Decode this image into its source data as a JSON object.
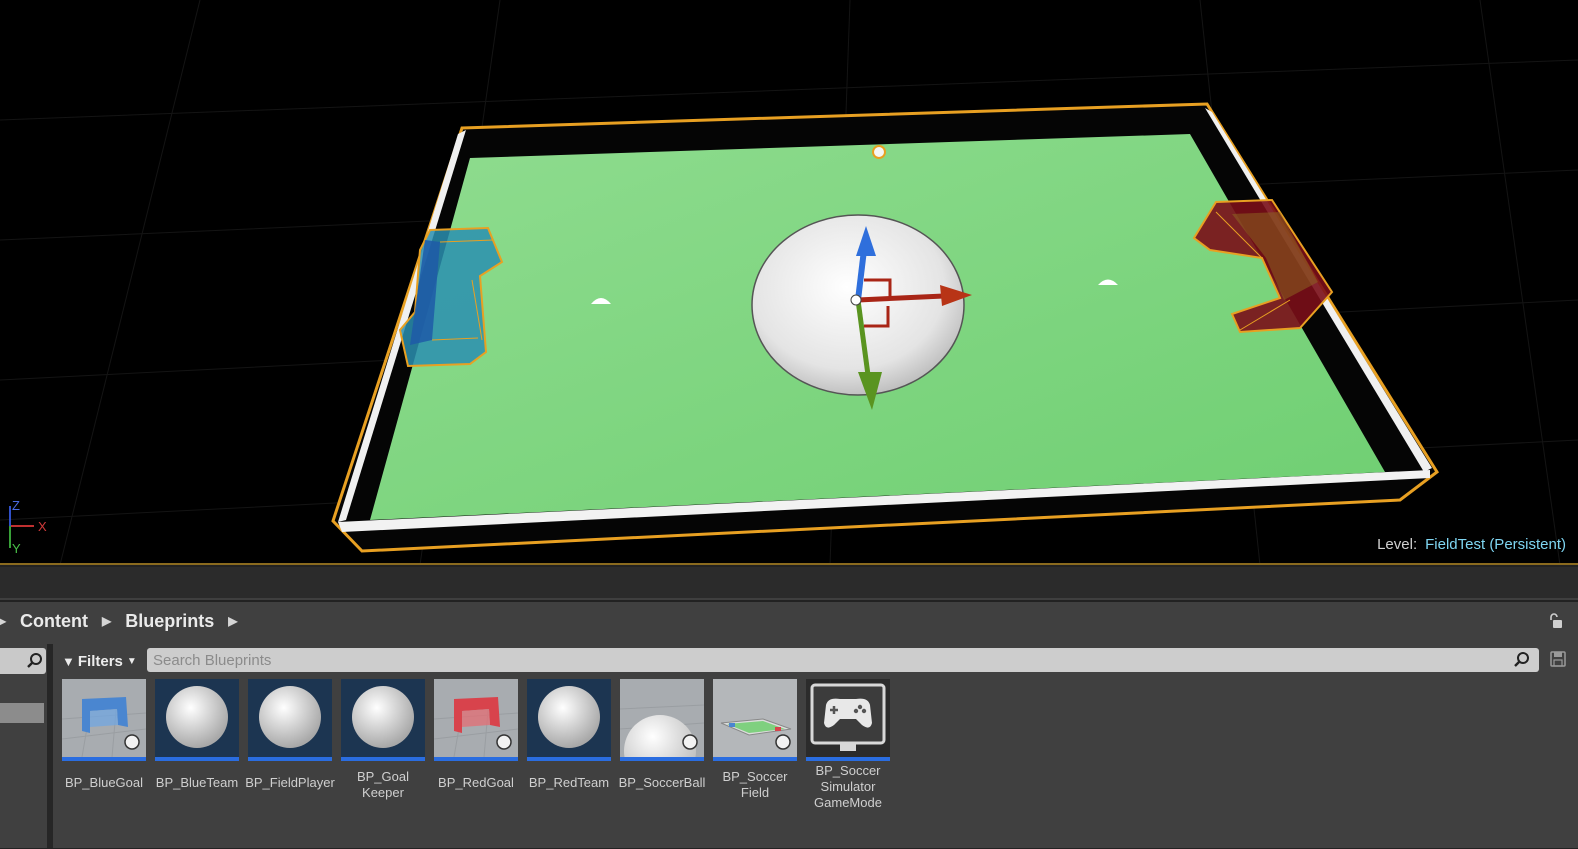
{
  "viewport": {
    "level_key": "Level:",
    "level_name": "FieldTest (Persistent)",
    "axis_labels": {
      "x": "X",
      "y": "Y",
      "z": "Z"
    }
  },
  "content_browser": {
    "breadcrumbs": [
      "Content",
      "Blueprints"
    ],
    "filters_label": "Filters",
    "search_placeholder": "Search Blueprints",
    "assets": [
      {
        "name": "BP_BlueGoal",
        "thumb": "blue-goal-icon"
      },
      {
        "name": "BP_BlueTeam",
        "thumb": "sphere-icon"
      },
      {
        "name": "BP_FieldPlayer",
        "thumb": "sphere-icon"
      },
      {
        "name": "BP_Goal\nKeeper",
        "thumb": "sphere-icon"
      },
      {
        "name": "BP_RedGoal",
        "thumb": "red-goal-icon"
      },
      {
        "name": "BP_RedTeam",
        "thumb": "sphere-icon"
      },
      {
        "name": "BP_SoccerBall",
        "thumb": "ball-icon"
      },
      {
        "name": "BP_Soccer\nField",
        "thumb": "field-icon"
      },
      {
        "name": "BP_Soccer\nSimulator\nGameMode",
        "thumb": "gamepad-icon"
      }
    ]
  },
  "colors": {
    "field_green": "#86d886",
    "selection_outline": "#e8a022",
    "blue_goal": "#2c7fb8",
    "red_goal": "#8a0f1a",
    "asset_underline": "#2a6de0",
    "level_name": "#7fd6f2"
  }
}
